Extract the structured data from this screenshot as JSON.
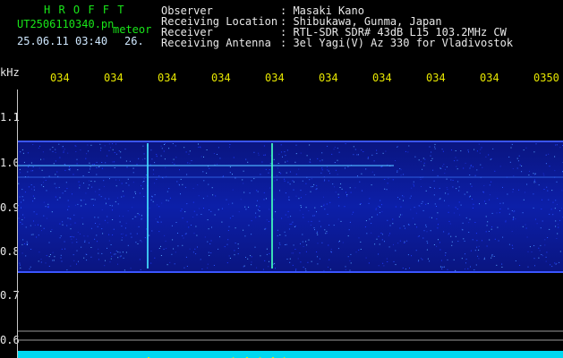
{
  "header": {
    "app_title": "H R O F F T",
    "filename": "UT2506110340.pn",
    "meteor_label": "meteor",
    "date_time": "25.06.11 03:40",
    "count": "26.",
    "observer_key": "Observer",
    "observer_val": ": Masaki Kano",
    "location_key": "Receiving Location",
    "location_val": ": Shibukawa, Gunma, Japan",
    "receiver_key": "Receiver",
    "receiver_val": ": RTL-SDR SDR# 43dB L15 103.2MHz CW",
    "antenna_key": "Receiving Antenna",
    "antenna_val": ": 3el Yagi(V) Az 330 for Vladivostok"
  },
  "time_axis": {
    "ticks": [
      "034",
      "034",
      "034",
      "034",
      "034",
      "034",
      "034",
      "034",
      "034",
      "0350"
    ]
  },
  "freq_axis": {
    "unit": "kHz",
    "ticks": [
      "1.1",
      "1.0",
      "0.9",
      "0.8",
      "0.7",
      "0.6"
    ]
  },
  "colors": {
    "background": "#000000",
    "noise_band": "#0a1a9a",
    "signal": "#3fd0ff",
    "meteor": "#e6e600",
    "strip": "#00d8f0"
  }
}
